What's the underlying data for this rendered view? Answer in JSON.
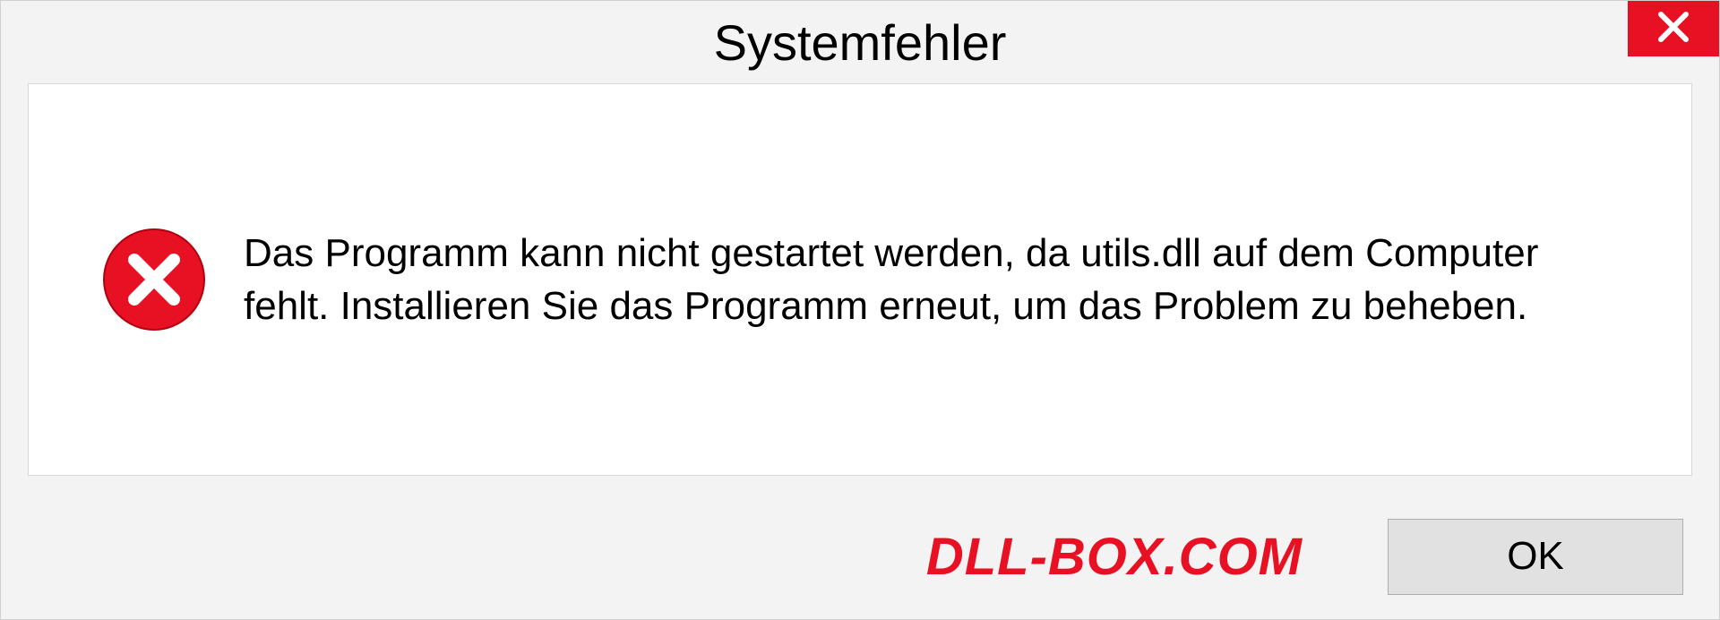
{
  "dialog": {
    "title": "Systemfehler",
    "message": "Das Programm kann nicht gestartet werden, da utils.dll auf dem Computer fehlt. Installieren Sie das Programm erneut, um das Problem zu beheben.",
    "ok_label": "OK"
  },
  "watermark": "DLL-BOX.COM",
  "colors": {
    "close_button": "#e81123",
    "watermark": "#e81123"
  }
}
